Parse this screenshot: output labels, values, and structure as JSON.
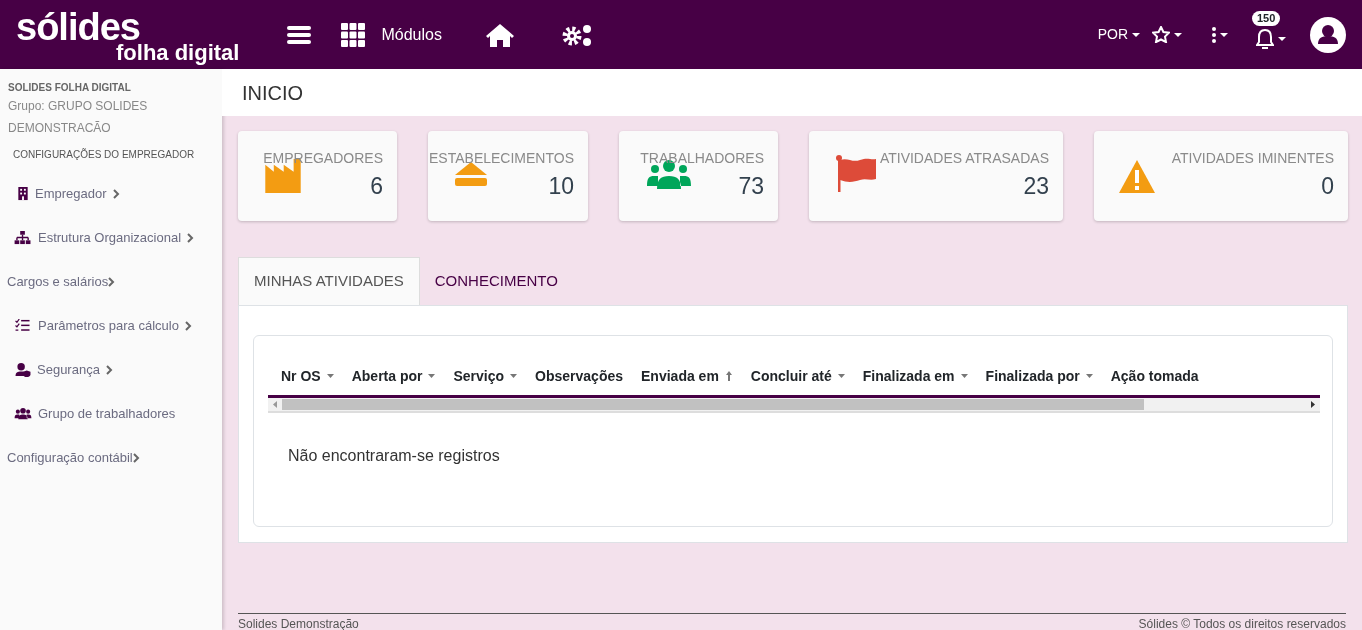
{
  "navbar": {
    "logo_top": "sólides",
    "logo_bottom": "folha digital",
    "modules_label": "Módulos",
    "language": "POR",
    "notification_count": "150"
  },
  "sidebar": {
    "company": "SOLIDES FOLHA DIGITAL",
    "group": "Grupo: GRUPO SOLIDES DEMONSTRACÃO",
    "section": "CONFIGURAÇÕES DO EMPREGADOR",
    "items": [
      {
        "label": "Empregador",
        "kind": "icon",
        "has_submenu": true
      },
      {
        "label": "Estrutura Organizacional",
        "kind": "icon",
        "has_submenu": true
      },
      {
        "label": "Cargos e salários",
        "kind": "plain",
        "has_submenu": true
      },
      {
        "label": "Parâmetros para cálculo",
        "kind": "icon",
        "has_submenu": true
      },
      {
        "label": "Segurança",
        "kind": "icon",
        "has_submenu": true
      },
      {
        "label": "Grupo de trabalhadores",
        "kind": "icon",
        "has_submenu": false
      },
      {
        "label": "Configuração contábil",
        "kind": "plain",
        "has_submenu": true
      }
    ]
  },
  "page_title": "INICIO",
  "stats": [
    {
      "label": "EMPREGADORES",
      "value": "6",
      "color": "#f39c12"
    },
    {
      "label": "ESTABELECIMENTOS",
      "value": "10",
      "color": "#f39c12"
    },
    {
      "label": "TRABALHADORES",
      "value": "73",
      "color": "#00a65a"
    },
    {
      "label": "ATIVIDADES ATRASADAS",
      "value": "23",
      "color": "#dd4b39"
    },
    {
      "label": "ATIVIDADES IMINENTES",
      "value": "0",
      "color": "#f39c12"
    }
  ],
  "tabs": [
    {
      "label": "MINHAS ATIVIDADES",
      "selected": true
    },
    {
      "label": "CONHECIMENTO",
      "selected": false
    }
  ],
  "table": {
    "columns": [
      {
        "label": "Nr OS",
        "sortable": true,
        "sorted": false
      },
      {
        "label": "Aberta por",
        "sortable": true,
        "sorted": false
      },
      {
        "label": "Serviço",
        "sortable": true,
        "sorted": false
      },
      {
        "label": "Observações",
        "sortable": false,
        "sorted": false
      },
      {
        "label": "Enviada em",
        "sortable": true,
        "sorted": true
      },
      {
        "label": "Concluir até",
        "sortable": true,
        "sorted": false
      },
      {
        "label": "Finalizada em",
        "sortable": true,
        "sorted": false
      },
      {
        "label": "Finalizada por",
        "sortable": true,
        "sorted": false
      },
      {
        "label": "Ação tomada",
        "sortable": false,
        "sorted": false
      }
    ],
    "empty_message": "Não encontraram-se registros"
  },
  "footer": {
    "left": "Solides Demonstração",
    "right": "Sólides © Todos os direitos reservados"
  }
}
